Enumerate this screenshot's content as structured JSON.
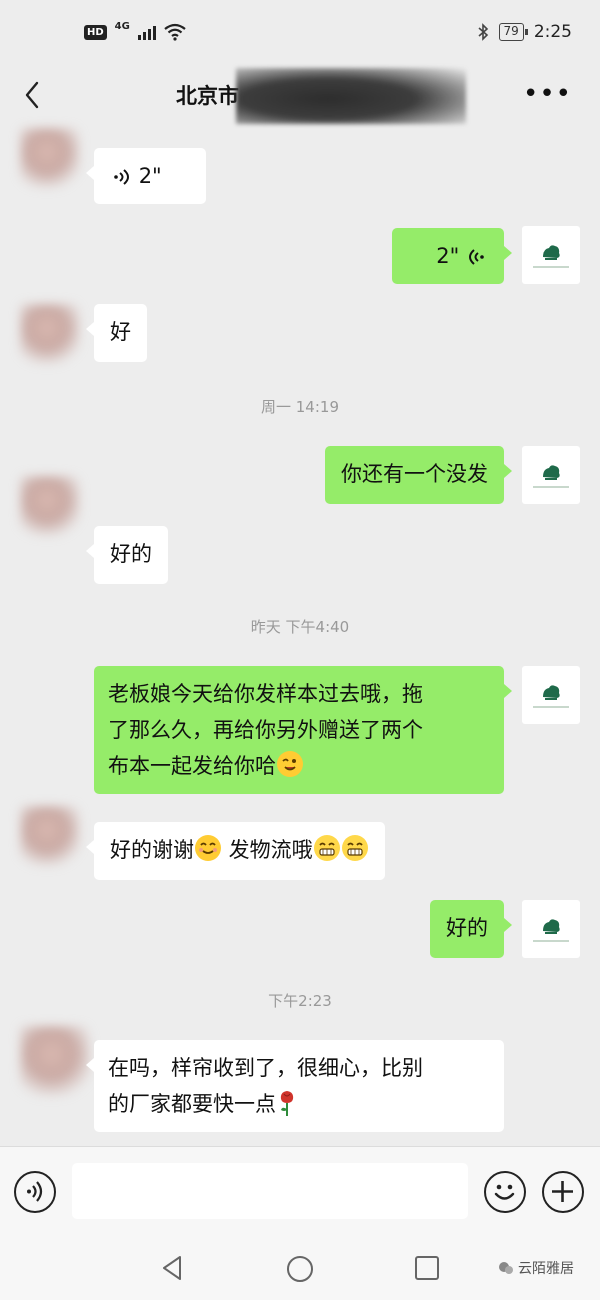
{
  "status_bar": {
    "hd": "HD",
    "network": "4G",
    "battery": "79",
    "time": "2:25"
  },
  "header": {
    "title": "北京市",
    "more_label": "•••"
  },
  "messages": [
    {
      "side": "left",
      "type": "voice",
      "duration": "2\""
    },
    {
      "side": "right",
      "type": "voice",
      "duration": "2\""
    },
    {
      "side": "left",
      "type": "text",
      "text": "好"
    },
    {
      "type": "time",
      "text": "周一 14:19"
    },
    {
      "side": "right",
      "type": "text",
      "text": "你还有一个没发"
    },
    {
      "side": "left",
      "type": "text",
      "text": "好的"
    },
    {
      "type": "time",
      "text": "昨天 下午4:40"
    },
    {
      "side": "right",
      "type": "text",
      "lines": [
        "老板娘今天给你发样本过去哦，拖",
        "了那么久，再给你另外赠送了两个",
        "布本一起发给你哈"
      ],
      "emoji": "wink"
    },
    {
      "side": "left",
      "type": "text",
      "part1": "好的谢谢",
      "part2": " 发物流哦",
      "emoji": [
        "smile",
        "grin",
        "grin"
      ]
    },
    {
      "side": "right",
      "type": "text",
      "text": "好的"
    },
    {
      "type": "time",
      "text": "下午2:23"
    },
    {
      "side": "left",
      "type": "text",
      "lines": [
        "在吗，样帘收到了，很细心，比别",
        "的厂家都要快一点"
      ],
      "emoji": "rose"
    }
  ],
  "input_bar": {
    "placeholder": ""
  },
  "watermark": {
    "text": "云陌雅居"
  },
  "colors": {
    "background": "#ededed",
    "bubble_self": "#95ec69",
    "bubble_other": "#ffffff",
    "timestamp": "#999999"
  }
}
